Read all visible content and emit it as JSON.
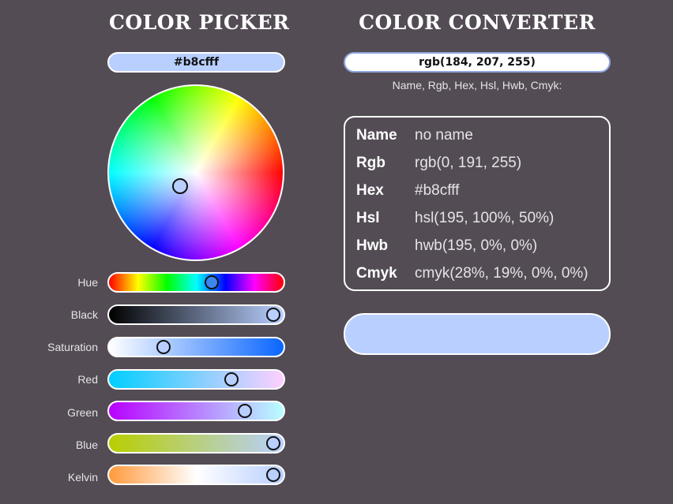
{
  "picker": {
    "title": "COLOR PICKER",
    "hex_value": "#b8cfff",
    "selected_color": "#b8cfff",
    "sliders": [
      {
        "id": "hue",
        "label": "Hue",
        "value": 0.59
      },
      {
        "id": "black",
        "label": "Black",
        "value": 0.94
      },
      {
        "id": "saturation",
        "label": "Saturation",
        "value": 0.31
      },
      {
        "id": "red",
        "label": "Red",
        "value": 0.7
      },
      {
        "id": "green",
        "label": "Green",
        "value": 0.78
      },
      {
        "id": "blue",
        "label": "Blue",
        "value": 0.94
      },
      {
        "id": "kelvin",
        "label": "Kelvin",
        "value": 0.94
      }
    ]
  },
  "converter": {
    "title": "COLOR CONVERTER",
    "input_value": "rgb(184, 207, 255)",
    "hint": "Name, Rgb, Hex, Hsl, Hwb, Cmyk:",
    "rows": [
      {
        "key": "Name",
        "value": "no name"
      },
      {
        "key": "Rgb",
        "value": "rgb(0, 191, 255)"
      },
      {
        "key": "Hex",
        "value": "#b8cfff"
      },
      {
        "key": "Hsl",
        "value": "hsl(195, 100%, 50%)"
      },
      {
        "key": "Hwb",
        "value": "hwb(195, 0%, 0%)"
      },
      {
        "key": "Cmyk",
        "value": "cmyk(28%, 19%, 0%, 0%)"
      }
    ],
    "swatch_color": "#b8cfff"
  }
}
